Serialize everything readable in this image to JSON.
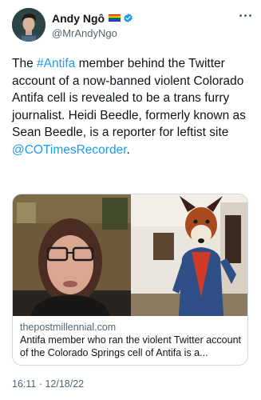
{
  "author": {
    "display_name": "Andy Ngô",
    "handle": "@MrAndyNgo",
    "verified": true,
    "flag_icon": "rainbow-flag-icon",
    "avatar_icon": "avatar"
  },
  "tweet": {
    "segments": [
      {
        "text": "The ",
        "link": false
      },
      {
        "text": "#Antifa",
        "link": true
      },
      {
        "text": " member behind the Twitter account of a now-banned violent Colorado Antifa cell is revealed to be a trans furry journalist. Heidi Beedle, formerly known as Sean Beedle, is a reporter for leftist site ",
        "link": false
      },
      {
        "text": "@COTimesRecorder",
        "link": true
      },
      {
        "text": ".",
        "link": false
      }
    ]
  },
  "card": {
    "domain": "thepostmillennial.com",
    "title": "Antifa member who ran the violent Twitter account of the Colorado Springs cell of Antifa is a..."
  },
  "timestamp": "16:11 · 12/18/22",
  "colors": {
    "link": "#1d9bf0",
    "verified": "#1d9bf0",
    "secondary_text": "#536471",
    "border": "#cfd9de"
  },
  "flag_colors": [
    "#e40303",
    "#ff8c00",
    "#ffed00",
    "#008026",
    "#004dff",
    "#750787"
  ]
}
